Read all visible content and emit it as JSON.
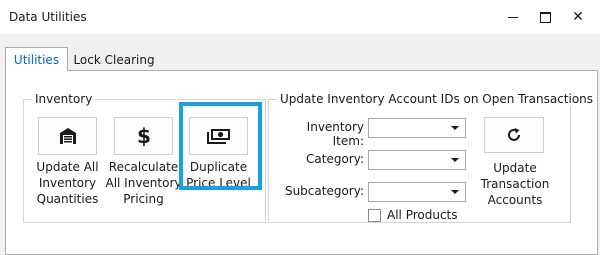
{
  "window": {
    "title": "Data Utilities",
    "close_glyph": "✕"
  },
  "tabs": [
    {
      "label": "Utilities",
      "selected": true
    },
    {
      "label": "Lock Clearing",
      "selected": false
    }
  ],
  "inventory_group": {
    "legend": "Inventory",
    "buttons": [
      {
        "label": "Update All Inventory Quantities",
        "icon": "warehouse-icon"
      },
      {
        "label": "Recalculate All Inventory Pricing",
        "icon": "dollar-sign-icon"
      },
      {
        "label": "Duplicate Price Level",
        "icon": "money-stack-icon",
        "selected": true
      }
    ]
  },
  "update_group": {
    "legend": "Update Inventory Account IDs on Open Transactions",
    "fields": [
      {
        "label": "Inventory Item:",
        "value": ""
      },
      {
        "label": "Category:",
        "value": ""
      },
      {
        "label": "Subcategory:",
        "value": ""
      }
    ],
    "all_products": {
      "label": "All Products",
      "checked": false
    },
    "action_button": {
      "label": "Update Transaction Accounts",
      "icon": "refresh-icon"
    }
  },
  "colors": {
    "selected_outline": "#1a9fe0",
    "tab_selected_text": "#0066cc"
  }
}
